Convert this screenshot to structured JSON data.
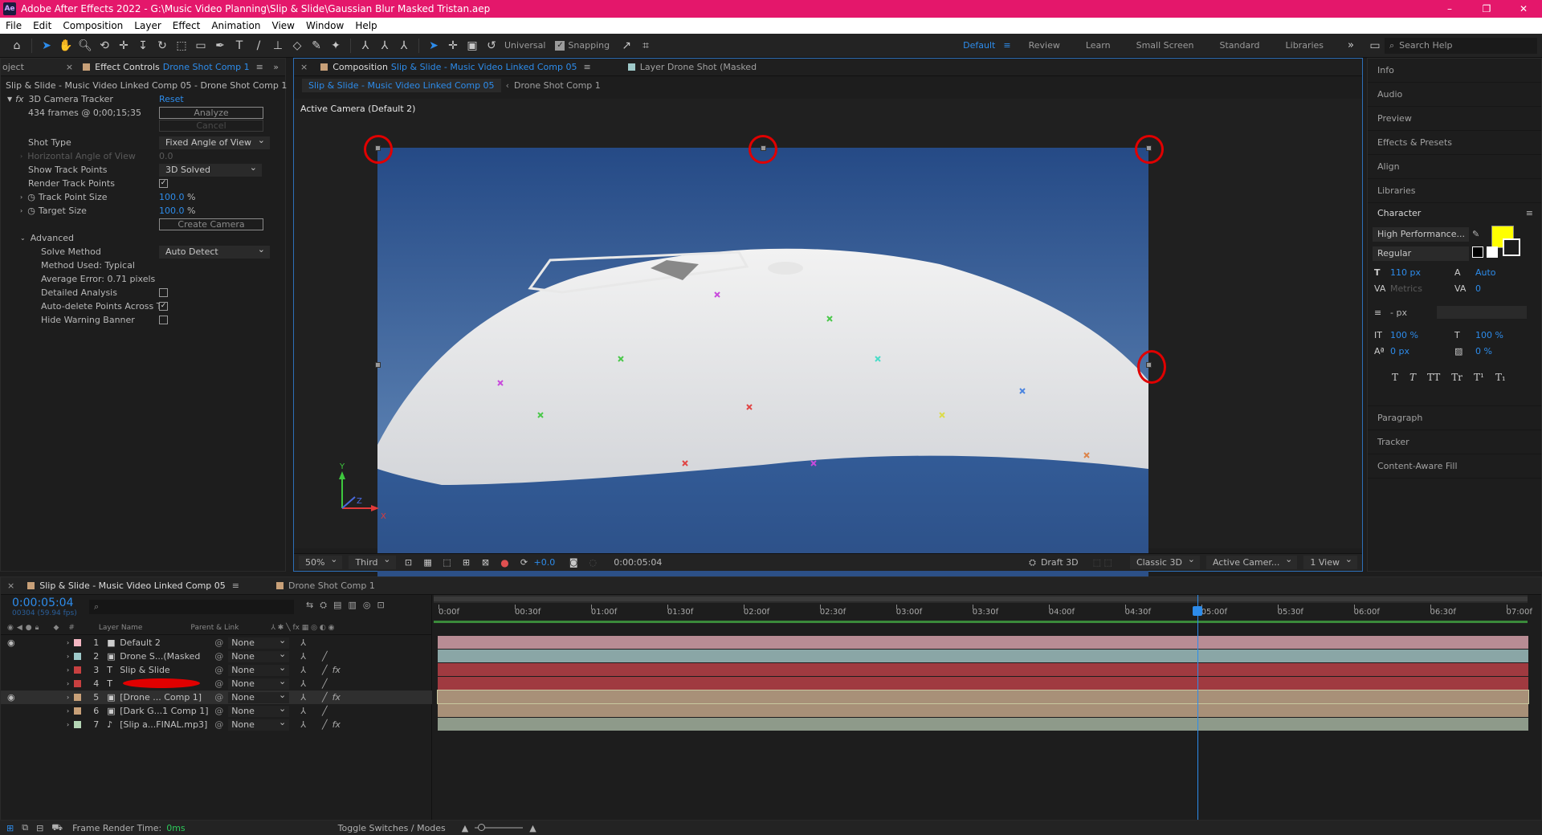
{
  "titlebar": {
    "logo": "Ae",
    "title": "Adobe After Effects 2022 - G:\\Music Video Planning\\Slip & Slide\\Gaussian Blur Masked Tristan.aep",
    "minimize": "–",
    "maximize": "❐",
    "close": "✕"
  },
  "menu": [
    "File",
    "Edit",
    "Composition",
    "Layer",
    "Effect",
    "Animation",
    "View",
    "Window",
    "Help"
  ],
  "toolbar": {
    "universal": "Universal",
    "snapping": "Snapping",
    "workspaces": [
      "Default",
      "Review",
      "Learn",
      "Small Screen",
      "Standard",
      "Libraries"
    ],
    "search": "Search Help",
    "more": "»"
  },
  "effect_controls": {
    "tab_project": "oject",
    "tab_label": "Effect Controls",
    "tab_comp": "Drone Shot Comp 1",
    "header": "Slip & Slide - Music Video Linked Comp 05 - Drone Shot Comp 1",
    "effect_name": "3D Camera Tracker",
    "reset": "Reset",
    "frames": "434 frames @ 0;00;15;35",
    "analyze": "Analyze",
    "cancel": "Cancel",
    "shot_type_label": "Shot Type",
    "shot_type_value": "Fixed Angle of View",
    "haov_label": "Horizontal Angle of View",
    "haov_value": "0.0",
    "show_track_label": "Show Track Points",
    "show_track_value": "3D Solved",
    "render_track_label": "Render Track Points",
    "track_size_label": "Track Point Size",
    "track_size_value": "100.0",
    "target_size_label": "Target Size",
    "target_size_value": "100.0",
    "percent": "%",
    "create_camera": "Create Camera",
    "advanced_label": "Advanced",
    "solve_method_label": "Solve Method",
    "solve_method_value": "Auto Detect",
    "method_used": "Method Used: Typical",
    "avg_error": "Average Error: 0.71 pixels",
    "detailed_label": "Detailed Analysis",
    "autodelete_label": "Auto-delete Points Across Ti",
    "hide_warning_label": "Hide Warning Banner"
  },
  "composition": {
    "tab_label": "Composition",
    "tab_name": "Slip & Slide - Music Video Linked Comp 05",
    "layer_tab": "Layer  Drone Shot (Masked",
    "sub_tabs": [
      "Slip & Slide - Music Video Linked Comp 05",
      "Drone Shot Comp 1"
    ],
    "active_camera": "Active Camera (Default 2)",
    "axis_x": "X",
    "axis_y": "Y",
    "axis_z": "Z",
    "zoom": "50%",
    "resolution": "Third",
    "exposure": "+0.0",
    "timecode": "0:00:05:04",
    "draft3d": "Draft 3D",
    "renderer": "Classic 3D",
    "camera": "Active Camer...",
    "views": "1 View"
  },
  "right_panels": [
    "Info",
    "Audio",
    "Preview",
    "Effects & Presets",
    "Align",
    "Libraries"
  ],
  "character": {
    "title": "Character",
    "font": "High Performance...",
    "style": "Regular",
    "size": "110 px",
    "leading": "Auto",
    "kerning": "Metrics",
    "tracking": "0",
    "stroke": "- px",
    "vscale": "100 %",
    "hscale": "100 %",
    "baseline": "0 px",
    "tsume": "0 %",
    "fill_color": "#ffff00",
    "type_buttons": [
      "T",
      "T",
      "TT",
      "Tr",
      "T¹",
      "T₁"
    ]
  },
  "right_panels_lower": [
    "Paragraph",
    "Tracker",
    "Content-Aware Fill"
  ],
  "timeline": {
    "tab_comp": "Slip & Slide - Music Video Linked Comp 05",
    "tab_drone": "Drone Shot Comp 1",
    "timecode": "0:00:05:04",
    "fps": "00304 (59.94 fps)",
    "col_hash": "#",
    "col_layer": "Layer Name",
    "col_parent": "Parent & Link",
    "ruler": [
      "0:00f",
      "00:30f",
      "01:00f",
      "01:30f",
      "02:00f",
      "02:30f",
      "03:00f",
      "03:30f",
      "04:00f",
      "04:30f",
      "05:00f",
      "05:30f",
      "06:00f",
      "06:30f",
      "07:00f"
    ],
    "layers": [
      {
        "num": "1",
        "name": "Default 2",
        "parent": "None",
        "label": "#f4b6c2",
        "type": "camera",
        "bar": "#b88c94"
      },
      {
        "num": "2",
        "name": "Drone S...(Masked",
        "parent": "None",
        "label": "#9ec9c9",
        "type": "precomp",
        "bar": "#8aa6a6"
      },
      {
        "num": "3",
        "name": "Slip  &  Slide",
        "parent": "None",
        "label": "#c84040",
        "type": "text",
        "bar": "#a03a40"
      },
      {
        "num": "4",
        "name": "",
        "parent": "None",
        "label": "#c84040",
        "type": "text",
        "bar": "#a03a40"
      },
      {
        "num": "5",
        "name": "[Drone ... Comp 1]",
        "parent": "None",
        "label": "#c8a078",
        "type": "precomp",
        "bar": "#a89078"
      },
      {
        "num": "6",
        "name": "[Dark G...1 Comp 1]",
        "parent": "None",
        "label": "#c8a078",
        "type": "precomp",
        "bar": "#a89078"
      },
      {
        "num": "7",
        "name": "[Slip a...FINAL.mp3]",
        "parent": "None",
        "label": "#b4d4b4",
        "type": "audio",
        "bar": "#8e9a8a"
      }
    ]
  },
  "status": {
    "frame_render_label": "Frame Render Time:",
    "frame_render_value": "0ms",
    "toggle": "Toggle Switches / Modes"
  },
  "colors": {
    "accent": "#2d8ceb",
    "titlebar": "#e4176b",
    "annotation": "#e00000"
  }
}
